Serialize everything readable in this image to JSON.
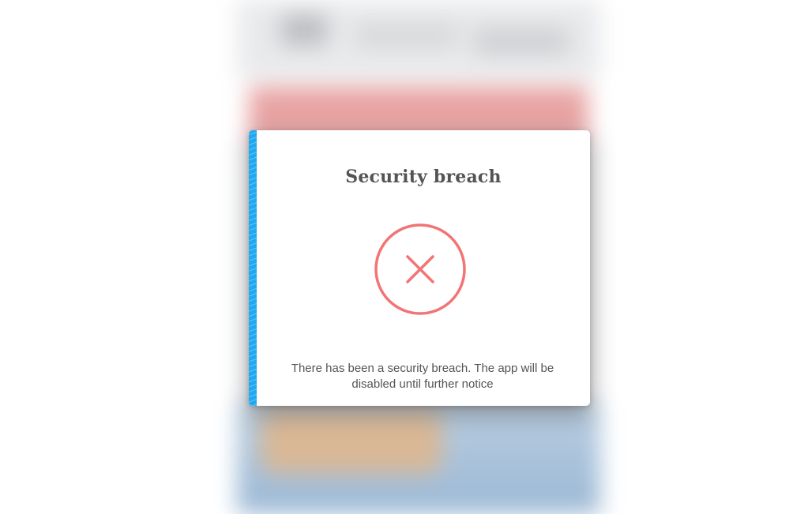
{
  "dialog": {
    "title": "Security breach",
    "message": "There has been a security breach. The app will be disabled until further notice",
    "icon": "error-x-icon"
  },
  "colors": {
    "error_red": "#f27474",
    "stripe_blue": "#22a8f0",
    "title_text": "#545454",
    "overlay_alert": "#e8a3a3"
  }
}
